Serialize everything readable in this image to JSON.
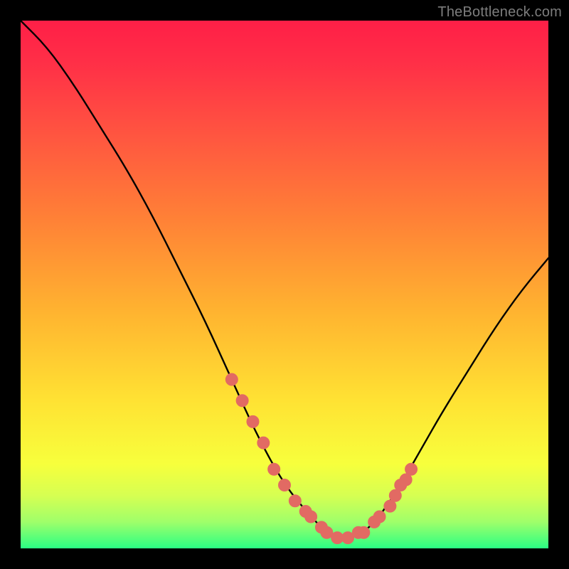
{
  "watermark": "TheBottleneck.com",
  "colors": {
    "background": "#000000",
    "curve_stroke": "#000000",
    "marker_fill": "#e26a63",
    "marker_stroke": "#e26a63"
  },
  "chart_data": {
    "type": "line",
    "title": "",
    "xlabel": "",
    "ylabel": "",
    "xlim": [
      0,
      100
    ],
    "ylim": [
      0,
      100
    ],
    "series": [
      {
        "name": "bottleneck-curve",
        "x": [
          0,
          5,
          10,
          15,
          20,
          25,
          30,
          35,
          40,
          45,
          50,
          55,
          58,
          60,
          62,
          65,
          68,
          72,
          76,
          80,
          85,
          90,
          95,
          100
        ],
        "y": [
          100,
          95,
          88,
          80,
          72,
          63,
          53,
          43,
          32,
          21,
          12,
          6,
          3,
          2,
          2,
          3,
          6,
          12,
          19,
          26,
          34,
          42,
          49,
          55
        ]
      }
    ],
    "markers": {
      "name": "highlighted-range",
      "x": [
        40,
        42,
        44,
        46,
        48,
        50,
        52,
        54,
        55,
        57,
        58,
        60,
        62,
        64,
        65,
        67,
        68,
        70,
        71,
        72,
        73,
        74
      ],
      "y": [
        32,
        28,
        24,
        20,
        15,
        12,
        9,
        7,
        6,
        4,
        3,
        2,
        2,
        3,
        3,
        5,
        6,
        8,
        10,
        12,
        13,
        15
      ]
    }
  }
}
